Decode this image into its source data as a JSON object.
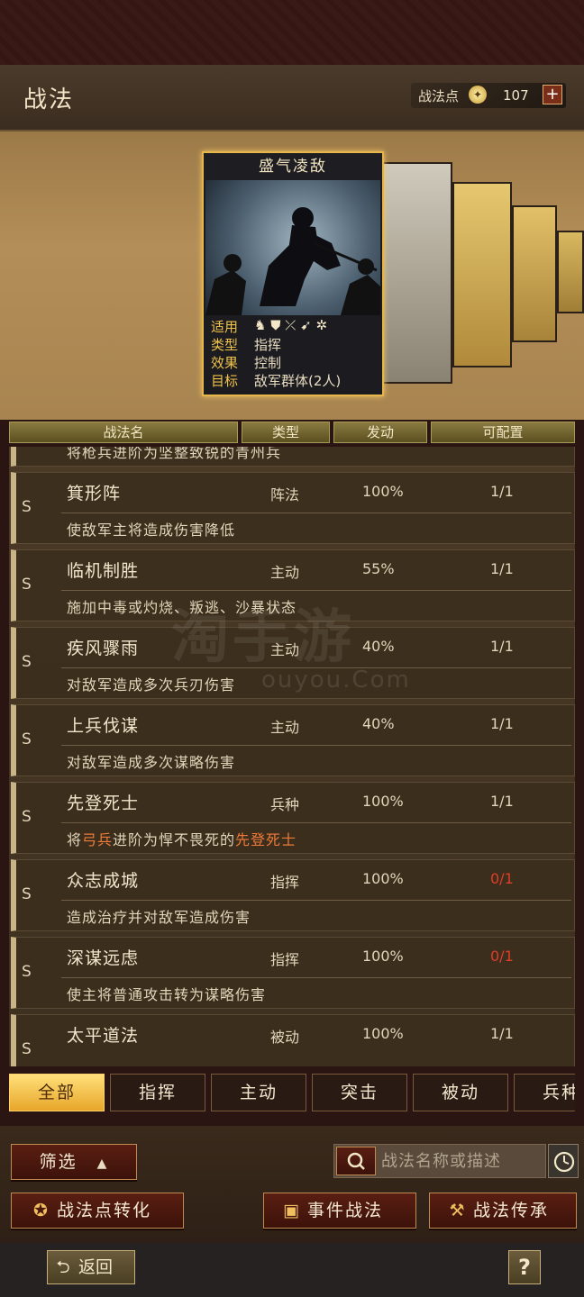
{
  "header": {
    "title": "战法",
    "points_label": "战法点",
    "points_value": "107",
    "plus_label": "+"
  },
  "featured_card": {
    "name": "盛气凌敌",
    "rows": [
      {
        "key": "适用",
        "value": ""
      },
      {
        "key": "类型",
        "value": "指挥"
      },
      {
        "key": "效果",
        "value": "控制"
      },
      {
        "key": "目标",
        "value": "敌军群体(2人)"
      }
    ],
    "applicable_icons": [
      "cavalry-icon",
      "shield-icon",
      "bow-icon",
      "spear-icon",
      "wheel-icon"
    ]
  },
  "table_headers": [
    "战法名",
    "类型",
    "发动",
    "可配置"
  ],
  "partial_top_row": {
    "desc": "将枪兵进阶为坚整致锐的青州兵"
  },
  "tactics": [
    {
      "grade": "S",
      "name": "箕形阵",
      "type": "阵法",
      "rate": "100%",
      "slots": "1/1",
      "slots_full": false,
      "desc": "使敌军主将造成伤害降低"
    },
    {
      "grade": "S",
      "name": "临机制胜",
      "type": "主动",
      "rate": "55%",
      "slots": "1/1",
      "slots_full": false,
      "desc": "施加中毒或灼烧、叛逃、沙暴状态"
    },
    {
      "grade": "S",
      "name": "疾风骤雨",
      "type": "主动",
      "rate": "40%",
      "slots": "1/1",
      "slots_full": false,
      "desc": "对敌军造成多次兵刃伤害"
    },
    {
      "grade": "S",
      "name": "上兵伐谋",
      "type": "主动",
      "rate": "40%",
      "slots": "1/1",
      "slots_full": false,
      "desc": "对敌军造成多次谋略伤害"
    },
    {
      "grade": "S",
      "name": "先登死士",
      "type": "兵种",
      "rate": "100%",
      "slots": "1/1",
      "slots_full": false,
      "desc_pre": "将",
      "desc_hl1": "弓兵",
      "desc_mid": "进阶为悍不畏死的",
      "desc_hl2": "先登死士"
    },
    {
      "grade": "S",
      "name": "众志成城",
      "type": "指挥",
      "rate": "100%",
      "slots": "0/1",
      "slots_full": true,
      "desc": "造成治疗并对敌军造成伤害"
    },
    {
      "grade": "S",
      "name": "深谋远虑",
      "type": "指挥",
      "rate": "100%",
      "slots": "0/1",
      "slots_full": true,
      "desc": "使主将普通攻击转为谋略伤害"
    },
    {
      "grade": "S",
      "name": "太平道法",
      "type": "被动",
      "rate": "100%",
      "slots": "1/1",
      "slots_full": false,
      "desc": ""
    }
  ],
  "filter_tabs": [
    "全部",
    "指挥",
    "主动",
    "突击",
    "被动",
    "兵种"
  ],
  "bottom": {
    "filter_label": "筛选",
    "search_placeholder": "战法名称或描述",
    "convert_label": "战法点转化",
    "event_label": "事件战法",
    "inherit_label": "战法传承"
  },
  "footer": {
    "back_label": "返回",
    "help_label": "?"
  },
  "watermark": {
    "main": "淘手游",
    "sub": "ouyou.Com"
  },
  "colors": {
    "accent_gold": "#e7b64a",
    "slot_full_red": "#e03c2a",
    "highlight_orange": "#ee7a3a"
  }
}
